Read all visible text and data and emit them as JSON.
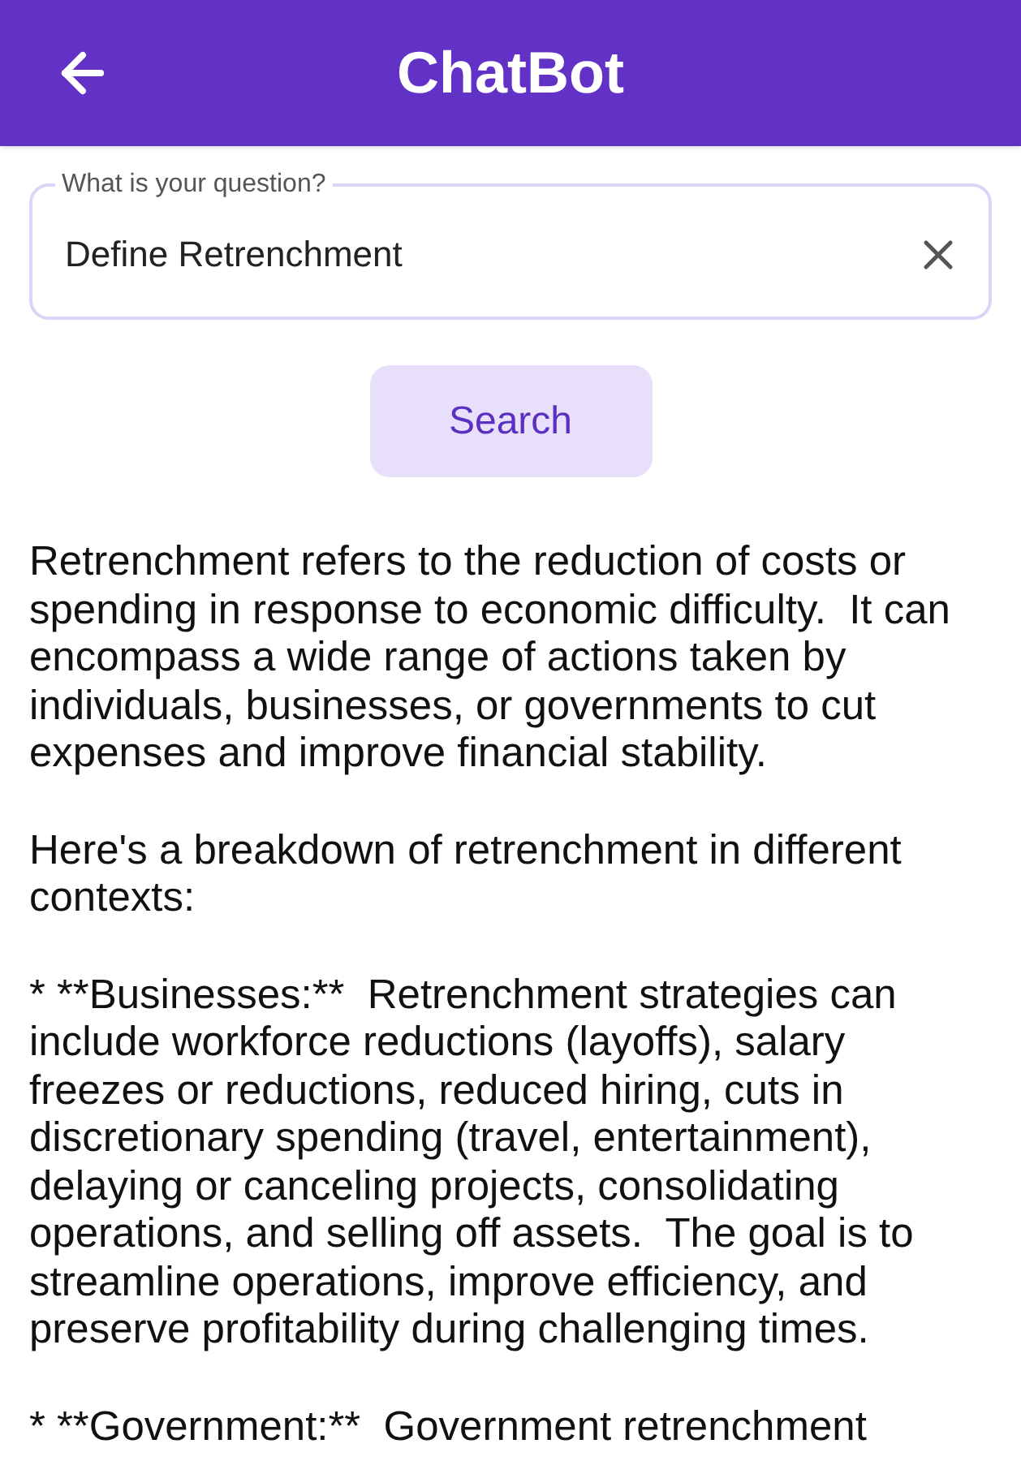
{
  "header": {
    "title": "ChatBot"
  },
  "question": {
    "label": "What is your question?",
    "value": "Define Retrenchment"
  },
  "search_button": "Search",
  "answer": [
    "Retrenchment refers to the reduction of costs or spending in response to economic difficulty.  It can encompass a wide range of actions taken by individuals, businesses, or governments to cut expenses and improve financial stability.",
    "Here's a breakdown of retrenchment in different contexts:",
    "* **Businesses:**  Retrenchment strategies can include workforce reductions (layoffs), salary freezes or reductions, reduced hiring, cuts in discretionary spending (travel, entertainment), delaying or canceling projects, consolidating operations, and selling off assets.  The goal is to streamline operations, improve efficiency, and preserve profitability during challenging times.",
    "* **Government:**  Government retrenchment"
  ]
}
